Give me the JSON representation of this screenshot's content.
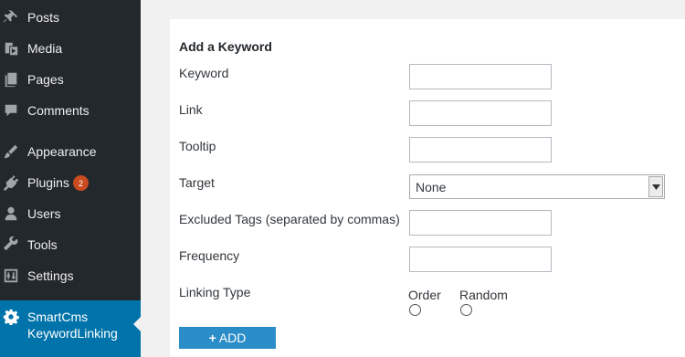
{
  "sidebar": {
    "items": [
      {
        "label": "Posts",
        "icon": "pin-icon"
      },
      {
        "label": "Media",
        "icon": "media-icon"
      },
      {
        "label": "Pages",
        "icon": "pages-icon"
      },
      {
        "label": "Comments",
        "icon": "comment-icon"
      },
      {
        "label": "Appearance",
        "icon": "brush-icon"
      },
      {
        "label": "Plugins",
        "icon": "plug-icon",
        "badge": "2"
      },
      {
        "label": "Users",
        "icon": "user-icon"
      },
      {
        "label": "Tools",
        "icon": "wrench-icon"
      },
      {
        "label": "Settings",
        "icon": "settings-icon"
      }
    ],
    "active": {
      "line1": "SmartCms",
      "line2": "KeywordLinking",
      "icon": "gear-icon"
    },
    "colors": {
      "bg": "#23282d",
      "active": "#0073aa",
      "badge": "#ca4a1f"
    }
  },
  "form": {
    "title": "Add a Keyword",
    "keyword_label": "Keyword",
    "keyword_value": "",
    "link_label": "Link",
    "link_value": "",
    "tooltip_label": "Tooltip",
    "tooltip_value": "",
    "target_label": "Target",
    "target_selected": "None",
    "excluded_label": "Excluded Tags (separated by commas)",
    "excluded_value": "",
    "frequency_label": "Frequency",
    "frequency_value": "",
    "linking_type_label": "Linking Type",
    "option_order": "Order",
    "option_random": "Random",
    "add_button": "ADD"
  }
}
